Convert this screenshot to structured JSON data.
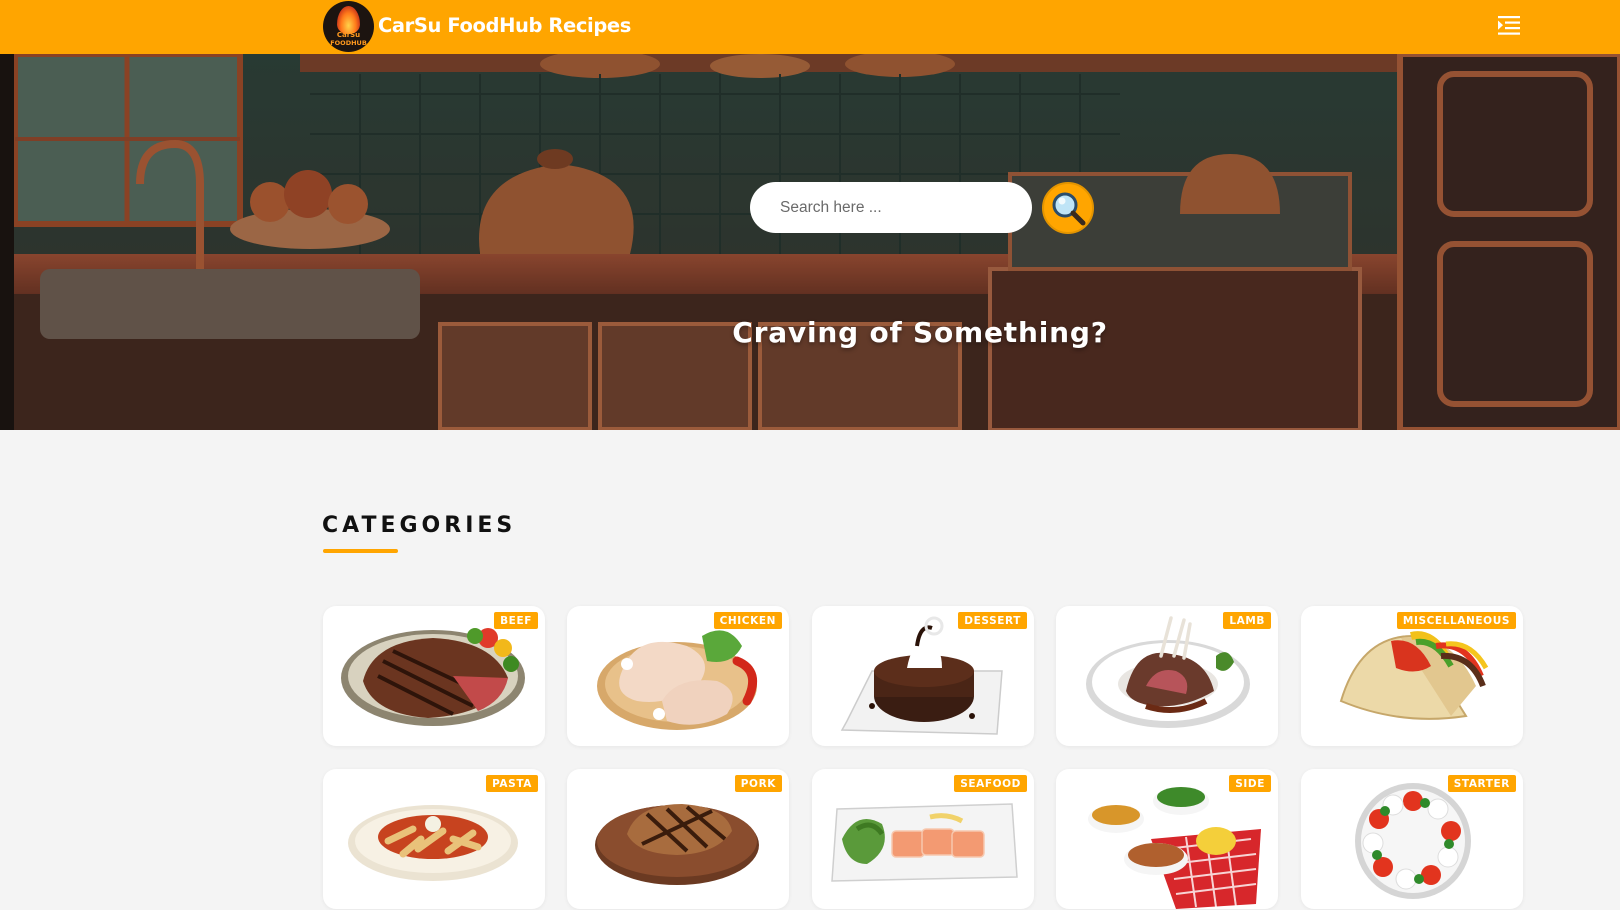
{
  "header": {
    "logo_text_top": "CarSu",
    "logo_text_bottom": "FOODHUB",
    "brand": "CarSu FoodHub Recipes",
    "menu_icon": "menu-list-icon",
    "brand_color": "#ffa500"
  },
  "hero": {
    "search_placeholder": "Search here ...",
    "search_icon": "magnifier-icon",
    "title": "Craving of Something?"
  },
  "categories": {
    "heading": "CATEGORIES",
    "items": [
      {
        "label": "BEEF",
        "icon": "beef-steak-image"
      },
      {
        "label": "CHICKEN",
        "icon": "raw-chicken-image"
      },
      {
        "label": "DESSERT",
        "icon": "chocolate-cake-image"
      },
      {
        "label": "LAMB",
        "icon": "lamb-chops-image"
      },
      {
        "label": "MISCELLANEOUS",
        "icon": "tacos-image"
      },
      {
        "label": "PASTA",
        "icon": "pasta-image"
      },
      {
        "label": "PORK",
        "icon": "pork-chop-image"
      },
      {
        "label": "SEAFOOD",
        "icon": "salmon-plate-image"
      },
      {
        "label": "SIDE",
        "icon": "side-dishes-image"
      },
      {
        "label": "STARTER",
        "icon": "caprese-salad-image"
      }
    ]
  }
}
